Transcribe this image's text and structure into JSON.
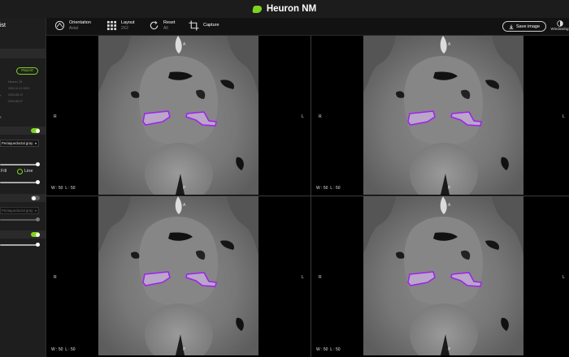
{
  "app": {
    "title": "Heuron NM"
  },
  "toolbar": {
    "orientation": {
      "label": "Orientation",
      "value": "Axial"
    },
    "layout": {
      "label": "Layout",
      "value": "2X2"
    },
    "reset": {
      "label": "Reset",
      "value": "All"
    },
    "capture": {
      "label": "Capture"
    },
    "save_image": "Save image",
    "windowing": "Windowing"
  },
  "sidebar": {
    "title": "ist",
    "report_button": "Report",
    "meta_lines": [
      "Heuron, 26",
      "2024-11-11 2024",
      "2024-08-13",
      "2024-08-27"
    ],
    "roi_select": "Periaqueductal gray",
    "fill_label": "Fill",
    "line_label": "Line",
    "roi_select_2": "Periaqueductal gray"
  },
  "viewports": [
    {
      "top": "A",
      "bottom": "P",
      "left": "R",
      "right": "L",
      "wl": "W : 50  L : 50"
    },
    {
      "top": "A",
      "bottom": "P",
      "left": "R",
      "right": "L",
      "wl": "W : 50  L : 50"
    },
    {
      "top": "A",
      "bottom": "P",
      "left": "R",
      "right": "L",
      "wl": "W : 50  L : 50"
    },
    {
      "top": "A",
      "bottom": "P",
      "left": "R",
      "right": "L",
      "wl": "W : 50  L : 50"
    }
  ],
  "colors": {
    "accent": "#7ed321",
    "roi_outline": "#a020f0",
    "roi_fill": "#b9a6c8"
  }
}
